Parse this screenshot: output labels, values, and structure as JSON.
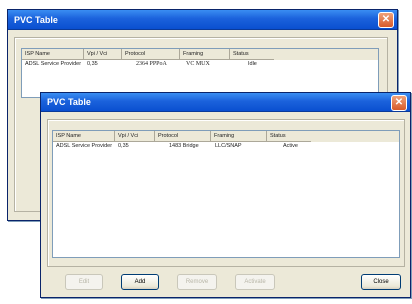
{
  "colors": {
    "titlebar": "#1b62dc",
    "window_bg": "#ece9d8",
    "close": "#d85a2a"
  },
  "back_window": {
    "title": "PVC Table",
    "close_icon": "close-icon",
    "columns": [
      "ISP Name",
      "Vpi / Vci",
      "Protocol",
      "Framing",
      "Status"
    ],
    "row": {
      "isp": "ADSL Service Provider",
      "vpivci": "0,35",
      "protocol": "2364 PPPoA",
      "framing": "VC MUX",
      "status": "Idle"
    }
  },
  "front_window": {
    "title": "PVC Table",
    "close_icon": "close-icon",
    "columns": [
      "ISP Name",
      "Vpi / Vci",
      "Protocol",
      "Framing",
      "Status"
    ],
    "row": {
      "isp": "ADSL Service Provider",
      "vpivci": "0,35",
      "protocol": "1483 Bridge",
      "framing": "LLC/SNAP",
      "status": "Active"
    },
    "buttons": {
      "edit": "Edit",
      "add": "Add",
      "remove": "Remove",
      "activate": "Activate",
      "close": "Close"
    }
  }
}
